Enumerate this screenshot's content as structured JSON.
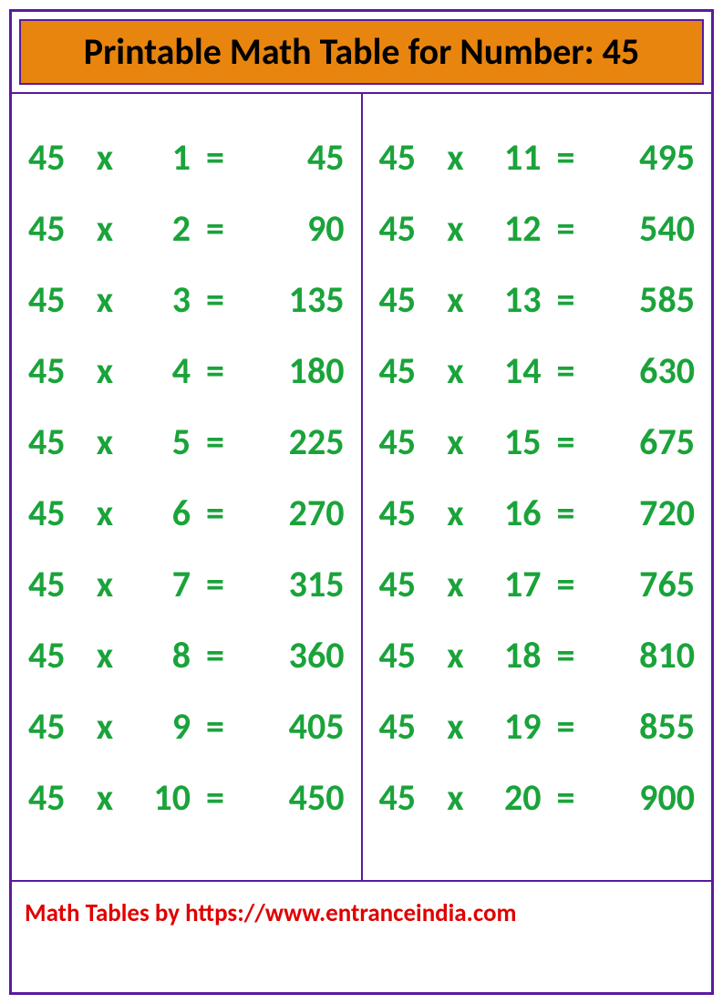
{
  "title": "Printable Math Table for Number: 45",
  "footer": "Math Tables by https://www.entranceindia.com",
  "symbols": {
    "times": "x",
    "equals": "="
  },
  "left": [
    {
      "a": 45,
      "b": 1,
      "r": 45
    },
    {
      "a": 45,
      "b": 2,
      "r": 90
    },
    {
      "a": 45,
      "b": 3,
      "r": 135
    },
    {
      "a": 45,
      "b": 4,
      "r": 180
    },
    {
      "a": 45,
      "b": 5,
      "r": 225
    },
    {
      "a": 45,
      "b": 6,
      "r": 270
    },
    {
      "a": 45,
      "b": 7,
      "r": 315
    },
    {
      "a": 45,
      "b": 8,
      "r": 360
    },
    {
      "a": 45,
      "b": 9,
      "r": 405
    },
    {
      "a": 45,
      "b": 10,
      "r": 450
    }
  ],
  "right": [
    {
      "a": 45,
      "b": 11,
      "r": 495
    },
    {
      "a": 45,
      "b": 12,
      "r": 540
    },
    {
      "a": 45,
      "b": 13,
      "r": 585
    },
    {
      "a": 45,
      "b": 14,
      "r": 630
    },
    {
      "a": 45,
      "b": 15,
      "r": 675
    },
    {
      "a": 45,
      "b": 16,
      "r": 720
    },
    {
      "a": 45,
      "b": 17,
      "r": 765
    },
    {
      "a": 45,
      "b": 18,
      "r": 810
    },
    {
      "a": 45,
      "b": 19,
      "r": 855
    },
    {
      "a": 45,
      "b": 20,
      "r": 900
    }
  ]
}
